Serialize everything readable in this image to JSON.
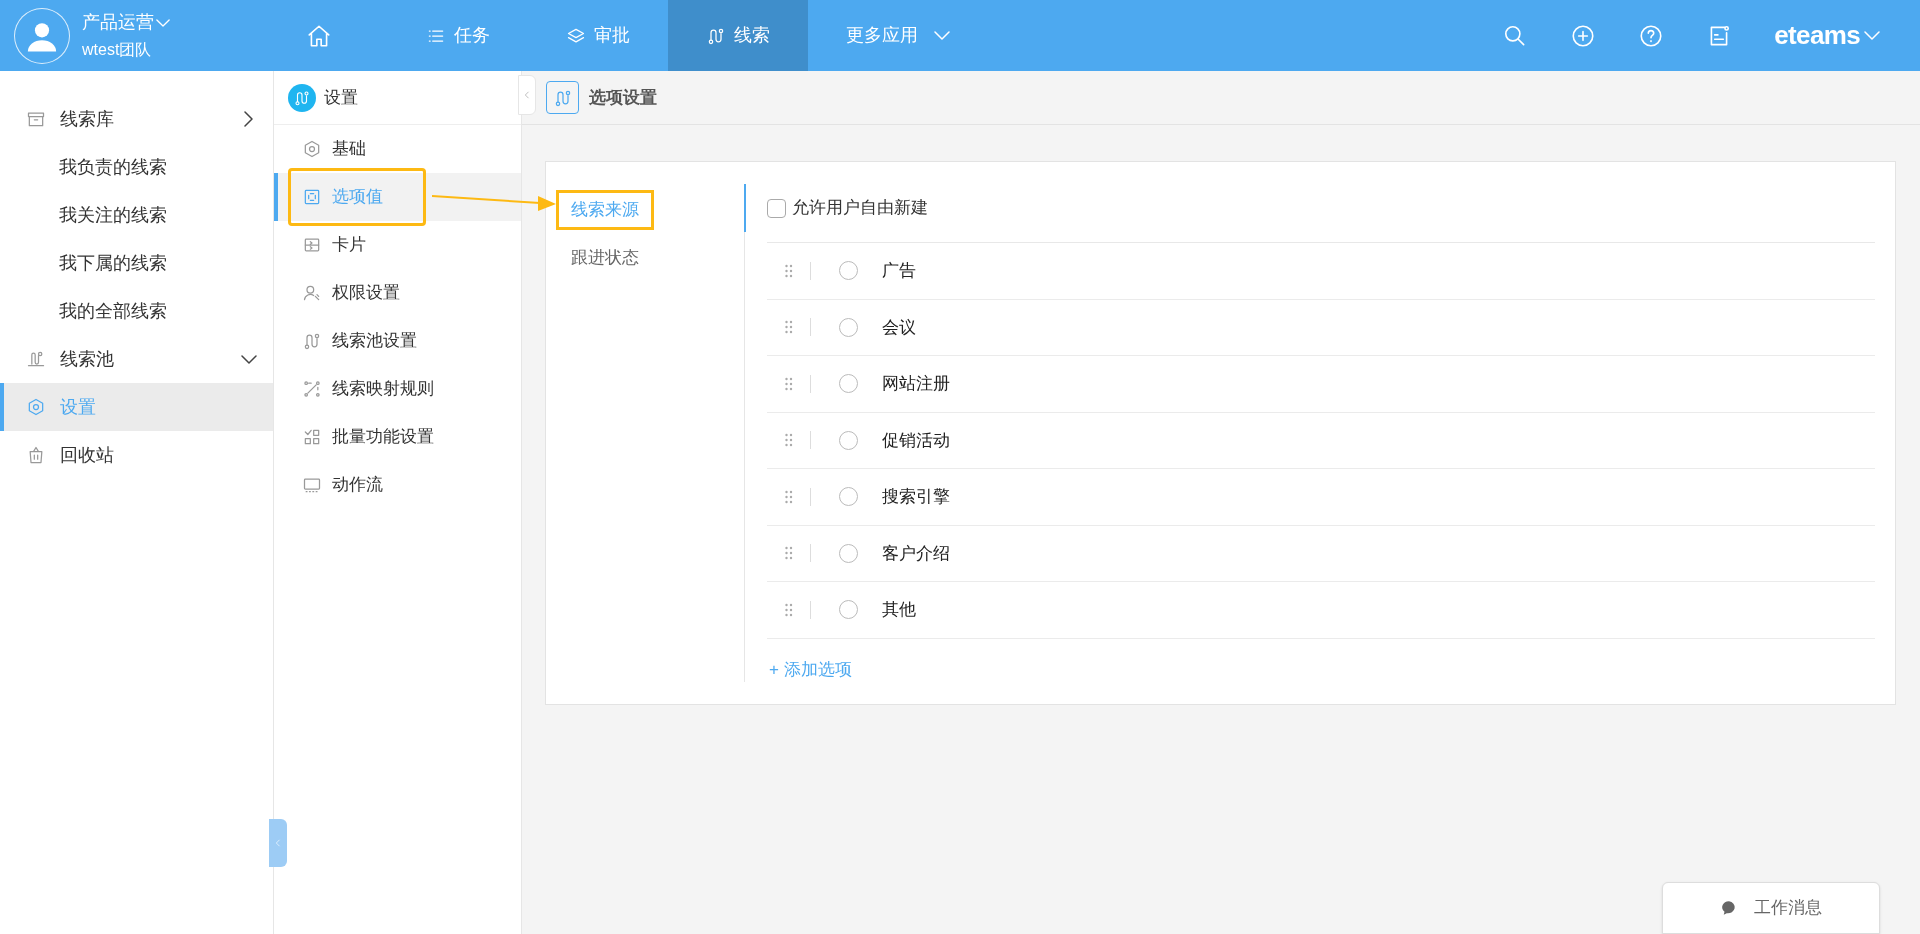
{
  "user": {
    "name": "产品运营",
    "team": "wtest团队"
  },
  "top_nav": [
    {
      "kind": "home",
      "selected": false
    },
    {
      "kind": "list",
      "label": "任务",
      "selected": false
    },
    {
      "kind": "layers",
      "label": "审批",
      "selected": false
    },
    {
      "kind": "clue",
      "label": "线索",
      "selected": true
    },
    {
      "kind": "more",
      "label": "更多应用",
      "selected": false
    }
  ],
  "brand": "eteams",
  "sidebar": {
    "items": [
      {
        "kind": "box",
        "label": "线索库",
        "expanded": false,
        "selected": false,
        "children": [
          {
            "label": "我负责的线索",
            "selected": false
          },
          {
            "label": "我关注的线索",
            "selected": false
          },
          {
            "label": "我下属的线索",
            "selected": false
          },
          {
            "label": "我的全部线索",
            "selected": false
          }
        ]
      },
      {
        "kind": "pool",
        "label": "线索池",
        "expanded": true,
        "selected": false
      },
      {
        "kind": "gear",
        "label": "设置",
        "selected": true
      },
      {
        "kind": "bin",
        "label": "回收站",
        "selected": false
      }
    ]
  },
  "settings_nav": {
    "title": "设置",
    "items": [
      {
        "kind": "gear",
        "label": "基础",
        "selected": false,
        "highlighted": false
      },
      {
        "kind": "frame",
        "label": "选项值",
        "selected": true,
        "highlighted": true
      },
      {
        "kind": "card",
        "label": "卡片",
        "selected": false,
        "highlighted": false
      },
      {
        "kind": "user",
        "label": "权限设置",
        "selected": false,
        "highlighted": false
      },
      {
        "kind": "clue",
        "label": "线索池设置",
        "selected": false,
        "highlighted": false
      },
      {
        "kind": "map",
        "label": "线索映射规则",
        "selected": false,
        "highlighted": false
      },
      {
        "kind": "grid",
        "label": "批量功能设置",
        "selected": false,
        "highlighted": false
      },
      {
        "kind": "screen",
        "label": "动作流",
        "selected": false,
        "highlighted": false
      }
    ]
  },
  "page": {
    "title": "选项设置"
  },
  "option_groups": [
    {
      "label": "线索来源",
      "selected": true,
      "highlighted": true
    },
    {
      "label": "跟进状态",
      "selected": false,
      "highlighted": false
    }
  ],
  "allow_custom": {
    "label": "允许用户自由新建",
    "checked": false
  },
  "options": [
    {
      "label": "广告",
      "selected": false
    },
    {
      "label": "会议",
      "selected": false
    },
    {
      "label": "网站注册",
      "selected": false
    },
    {
      "label": "促销活动",
      "selected": false
    },
    {
      "label": "搜索引擎",
      "selected": false
    },
    {
      "label": "客户介绍",
      "selected": false
    },
    {
      "label": "其他",
      "selected": false
    }
  ],
  "add_option": "+ 添加选项",
  "work_messages": "工作消息"
}
